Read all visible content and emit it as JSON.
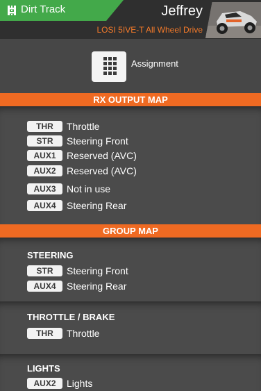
{
  "header": {
    "track_name": "Dirt Track",
    "user_name": "Jeffrey",
    "model_name": "LOSI 5IVE-T All Wheel Drive"
  },
  "assignment": {
    "label": "Assignment"
  },
  "rx_output_map": {
    "title": "RX OUTPUT MAP",
    "rows": [
      {
        "chip": "THR",
        "label": "Throttle"
      },
      {
        "chip": "STR",
        "label": "Steering Front"
      },
      {
        "chip": "AUX1",
        "label": "Reserved (AVC)"
      },
      {
        "chip": "AUX2",
        "label": "Reserved (AVC)"
      },
      {
        "chip": "AUX3",
        "label": "Not in use"
      },
      {
        "chip": "AUX4",
        "label": "Steering Rear"
      }
    ]
  },
  "group_map": {
    "title": "GROUP MAP",
    "groups": [
      {
        "name": "STEERING",
        "rows": [
          {
            "chip": "STR",
            "label": "Steering Front"
          },
          {
            "chip": "AUX4",
            "label": "Steering Rear"
          }
        ]
      },
      {
        "name": "THROTTLE / BRAKE",
        "rows": [
          {
            "chip": "THR",
            "label": "Throttle"
          }
        ]
      },
      {
        "name": "LIGHTS",
        "rows": [
          {
            "chip": "AUX2",
            "label": "Lights"
          }
        ]
      }
    ]
  },
  "colors": {
    "accent_orange": "#ef6a22",
    "track_green": "#43a94a",
    "model_text": "#f47a2a"
  }
}
